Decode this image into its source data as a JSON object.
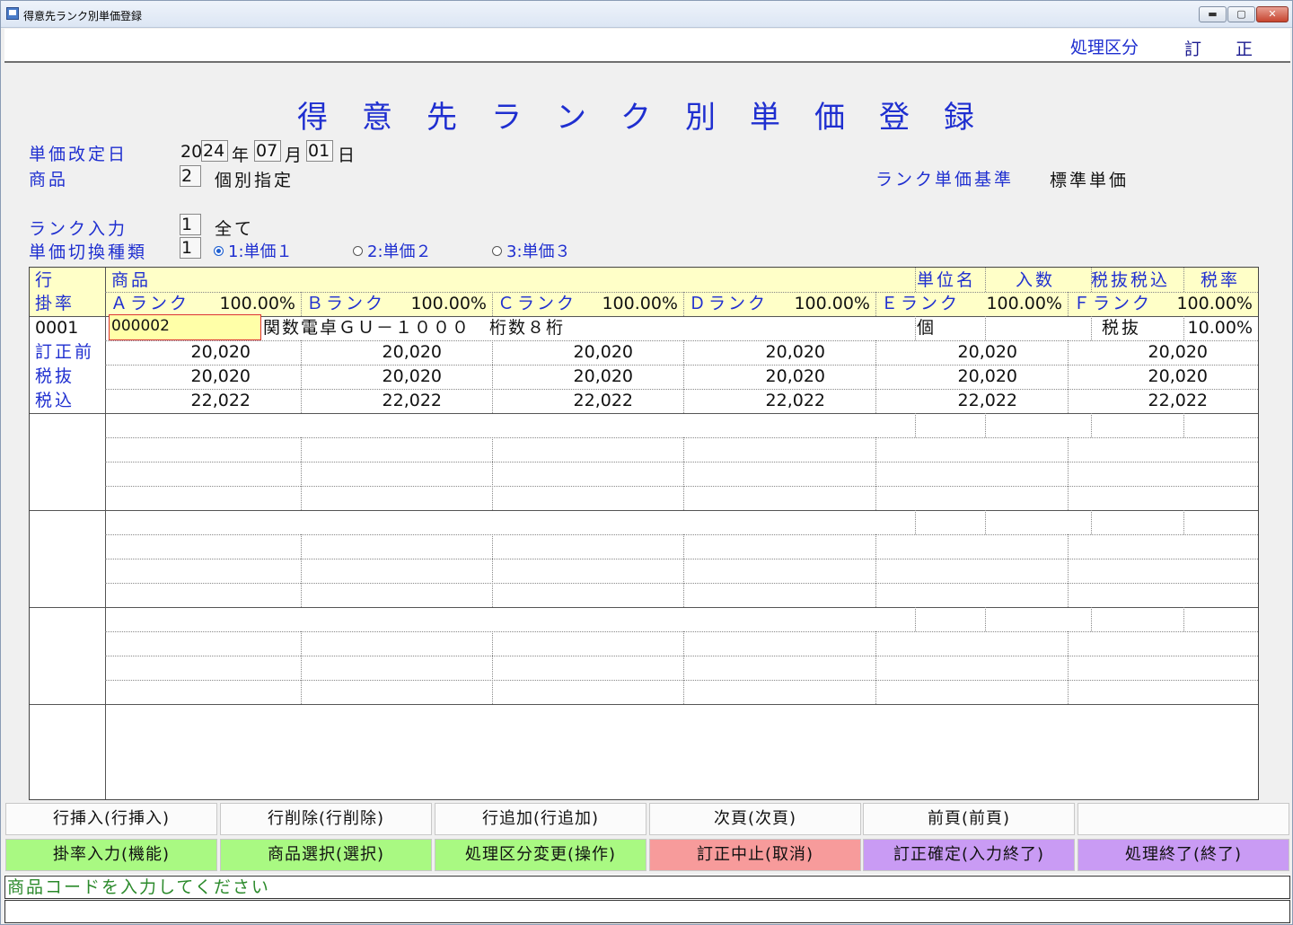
{
  "window": {
    "title": "得意先ランク別単価登録",
    "min": "▬",
    "max": "▢",
    "close": "✕"
  },
  "mode": {
    "label": "処理区分",
    "value": "訂正"
  },
  "page_title": "得意先ランク別単価登録",
  "form": {
    "date_label": "単価改定日",
    "date_prefix": "20",
    "date_year": "24",
    "date_year_unit": "年",
    "date_month": "07",
    "date_month_unit": "月",
    "date_day": "01",
    "date_day_unit": "日",
    "product_label": "商品",
    "product_code": "2",
    "product_text": "個別指定",
    "rank_basis_label": "ランク単価基準",
    "rank_basis_value": "標準単価",
    "rank_input_label": "ランク入力",
    "rank_input_code": "1",
    "rank_input_text": "全て",
    "price_switch_label": "単価切換種類",
    "price_switch_code": "1",
    "radios": [
      "1:単価１",
      "2:単価２",
      "3:単価３"
    ]
  },
  "grid": {
    "h_row": "行",
    "h_product": "商品",
    "h_unit": "単位名",
    "h_qty": "入数",
    "h_tax": "税抜税込",
    "h_rate": "税率",
    "h_kake": "掛率",
    "ranks": [
      {
        "name": "Ａランク",
        "pct": "100.00%"
      },
      {
        "name": "Ｂランク",
        "pct": "100.00%"
      },
      {
        "name": "Ｃランク",
        "pct": "100.00%"
      },
      {
        "name": "Ｄランク",
        "pct": "100.00%"
      },
      {
        "name": "Ｅランク",
        "pct": "100.00%"
      },
      {
        "name": "Ｆランク",
        "pct": "100.00%"
      }
    ],
    "row1": {
      "no": "0001",
      "code": "000002",
      "name": "関数電卓ＧＵ－１０００　桁数８桁",
      "unit": "個",
      "tax": "税抜",
      "rate": "10.00%",
      "label_before": "訂正前",
      "label_ex": "税抜",
      "label_in": "税込",
      "before": [
        "20,020",
        "20,020",
        "20,020",
        "20,020",
        "20,020",
        "20,020"
      ],
      "ex": [
        "20,020",
        "20,020",
        "20,020",
        "20,020",
        "20,020",
        "20,020"
      ],
      "inc": [
        "22,022",
        "22,022",
        "22,022",
        "22,022",
        "22,022",
        "22,022"
      ]
    }
  },
  "fkeys": {
    "row1": [
      "行挿入(行挿入)",
      "行削除(行削除)",
      "行追加(行追加)",
      "次頁(次頁)",
      "前頁(前頁)",
      ""
    ],
    "row2": [
      "掛率入力(機能)",
      "商品選択(選択)",
      "処理区分変更(操作)",
      "訂正中止(取消)",
      "訂正確定(入力終了)",
      "処理終了(終了)"
    ]
  },
  "message": "商品コードを入力してください",
  "colors": {
    "label_blue": "#1f2fd0",
    "header_yellow": "#ffffc8",
    "key_green": "#a9f982",
    "key_pink": "#f79b9b",
    "key_purple": "#c99bf4",
    "message_green": "#2b8a2b"
  }
}
